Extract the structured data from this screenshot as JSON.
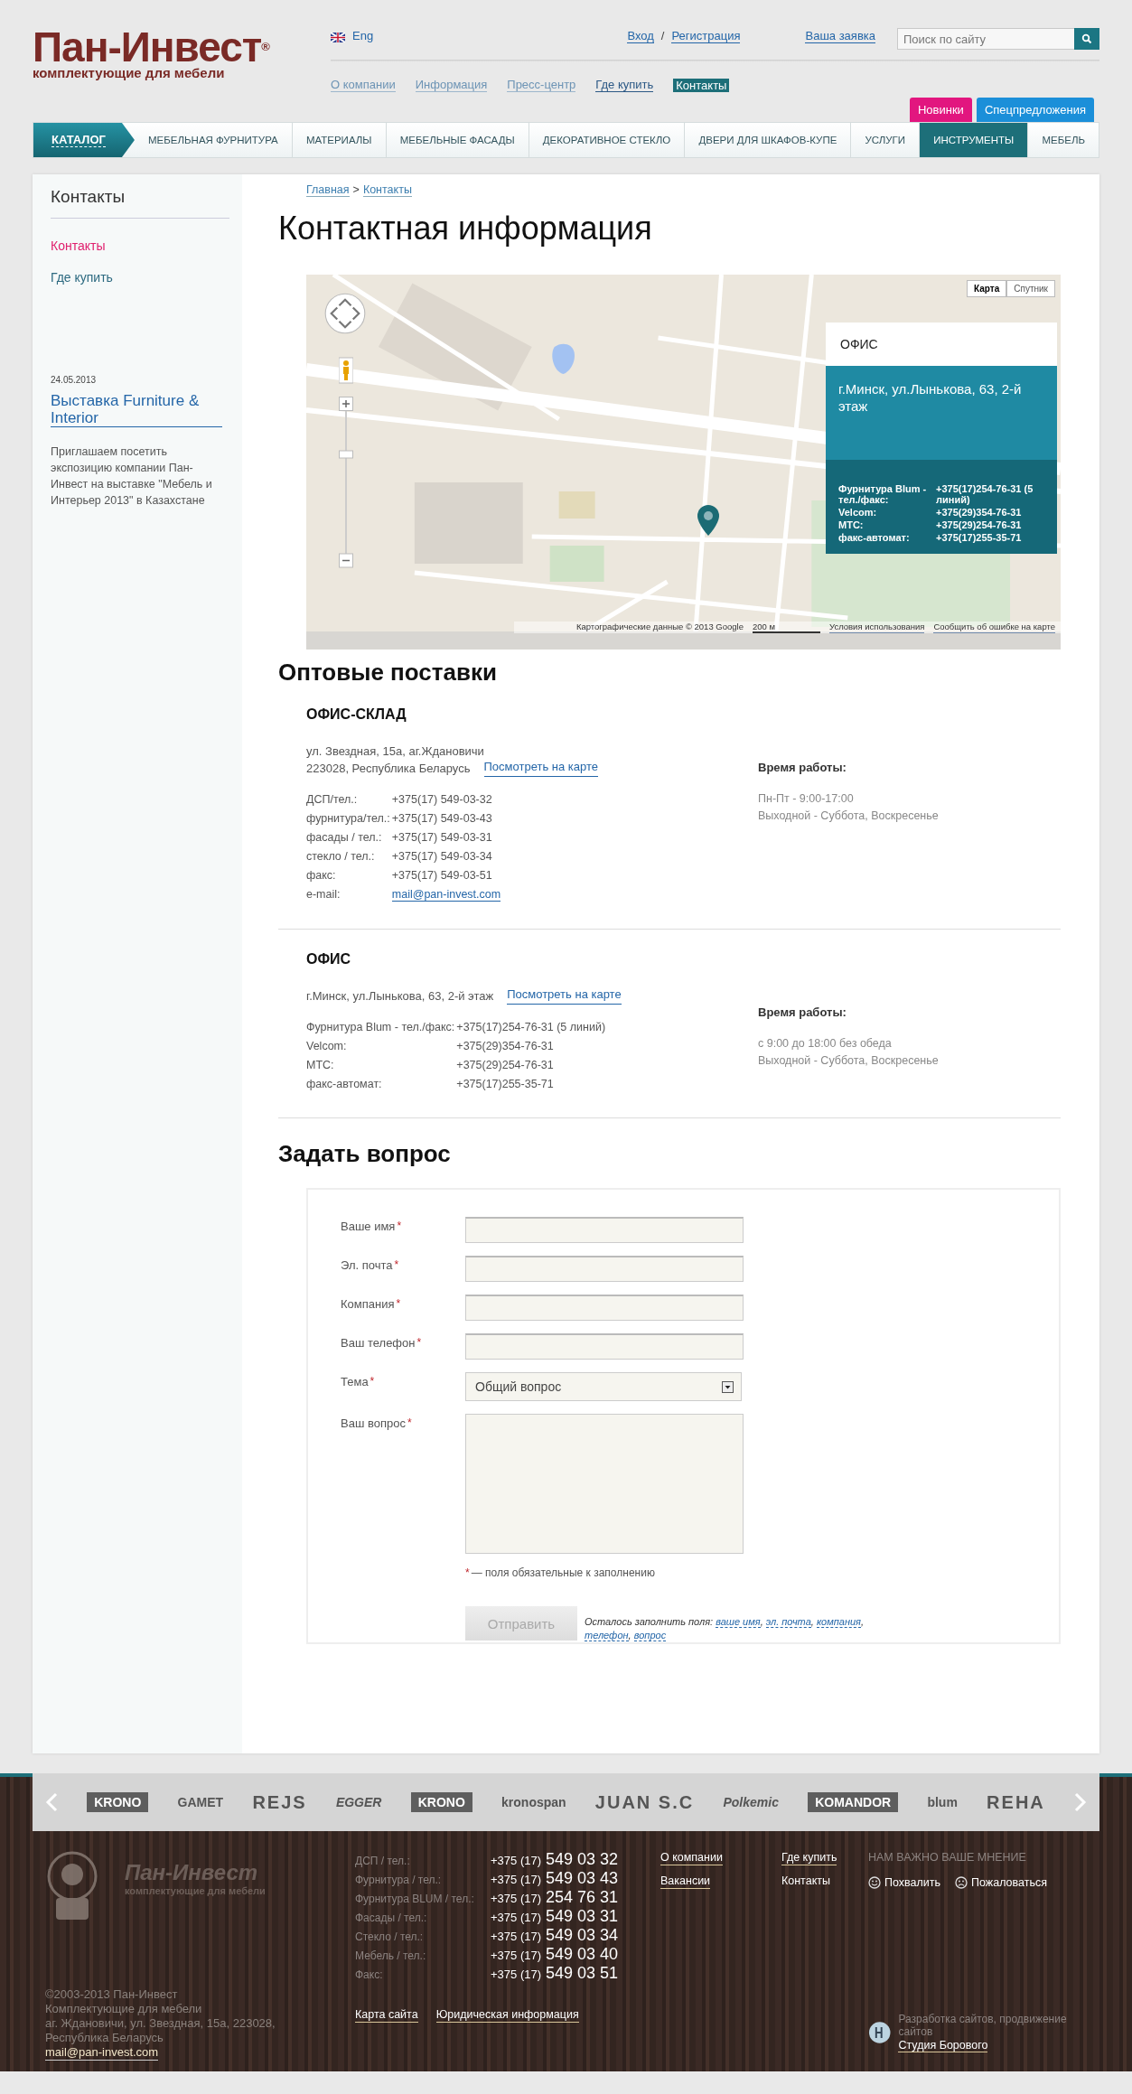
{
  "header": {
    "logo": {
      "title": "Пан-Инвест",
      "registered": "®",
      "tagline": "комплектующие для мебели"
    },
    "language": "Eng",
    "login": "Вход",
    "auth_separator": "/",
    "register": "Регистрация",
    "request_link": "Ваша заявка",
    "search": {
      "placeholder": "Поиск по сайту"
    },
    "top_nav": [
      {
        "label": "О компании",
        "selected": false
      },
      {
        "label": "Информация",
        "selected": false
      },
      {
        "label": "Пресс-центр",
        "selected": false
      },
      {
        "label": "Где купить",
        "selected": false
      },
      {
        "label": "Контакты",
        "selected": true
      }
    ],
    "promo_tabs": [
      {
        "label": "Новинки",
        "color": "#e2167f"
      },
      {
        "label": "Спецпредложения",
        "color": "#1b8fd9"
      }
    ],
    "catalog_nav": [
      {
        "label": "КАТАЛОГ",
        "kind": "catalog"
      },
      {
        "label": "МЕБЕЛЬНАЯ ФУРНИТУРА",
        "kind": "item",
        "selected": false
      },
      {
        "label": "МАТЕРИАЛЫ",
        "kind": "item",
        "selected": false
      },
      {
        "label": "МЕБЕЛЬНЫЕ ФАСАДЫ",
        "kind": "item",
        "selected": false
      },
      {
        "label": "ДЕКОРАТИВНОЕ СТЕКЛО",
        "kind": "item",
        "selected": false
      },
      {
        "label": "ДВЕРИ ДЛЯ ШКАФОВ-КУПЕ",
        "kind": "item",
        "selected": false
      },
      {
        "label": "УСЛУГИ",
        "kind": "item",
        "selected": false
      },
      {
        "label": "ИНСТРУМЕНТЫ",
        "kind": "item",
        "selected": true
      },
      {
        "label": "МЕБЕЛЬ",
        "kind": "item",
        "selected": false
      }
    ]
  },
  "sidebar": {
    "title": "Контакты",
    "items": [
      {
        "label": "Контакты",
        "selected": true
      },
      {
        "label": "Где купить",
        "selected": false
      }
    ],
    "news": {
      "date": "24.05.2013",
      "title": "Выставка Furniture & Interior",
      "text": "Приглашаем посетить экспозицию компании Пан-Инвест на выставке \"Мебель и Интерьер 2013\" в Казахстане"
    }
  },
  "breadcrumbs": {
    "items": [
      "Главная",
      "Контакты"
    ],
    "separator": ">"
  },
  "page_title": "Контактная информация",
  "map": {
    "buttons": [
      {
        "label": "Карта",
        "selected": true
      },
      {
        "label": "Спутник",
        "selected": false
      }
    ],
    "info": {
      "title": "ОФИС",
      "address": "г.Минск, ул.Лынькова, 63, 2-й этаж",
      "phones": [
        {
          "label": "Фурнитура Blum - тел./факс:",
          "value": "+375(17)254-76-31 (5 линий)"
        },
        {
          "label": "Velcom:",
          "value": "+375(29)354-76-31"
        },
        {
          "label": "МТС:",
          "value": "+375(29)254-76-31"
        },
        {
          "label": "факс-автомат:",
          "value": "+375(17)255-35-71"
        }
      ]
    },
    "attribution": "Картографические данные © 2013 Google",
    "scale": "200 м",
    "terms": "Условия использования",
    "report": "Сообщить об ошибке на карте"
  },
  "wholesale": {
    "title": "Оптовые поставки",
    "offices": [
      {
        "name": "ОФИС-СКЛАД",
        "address": [
          "ул. Звездная, 15а, аг.Ждановичи",
          "223028, Республика Беларусь"
        ],
        "map_link": "Посмотреть на карте",
        "phones": [
          {
            "label": "ДСП/тел.:",
            "value": "+375(17) 549-03-32",
            "kind": "text"
          },
          {
            "label": "фурнитура/тел.:",
            "value": "+375(17) 549-03-43",
            "kind": "text"
          },
          {
            "label": "фасады / тел.:",
            "value": "+375(17) 549-03-31",
            "kind": "text"
          },
          {
            "label": "стекло / тел.:",
            "value": "+375(17) 549-03-34",
            "kind": "text"
          },
          {
            "label": "факс:",
            "value": "+375(17) 549-03-51",
            "kind": "text"
          },
          {
            "label": "e-mail:",
            "value": "mail@pan-invest.com",
            "kind": "link"
          }
        ],
        "hours_title": "Время работы:",
        "hours": [
          "Пн-Пт - 9:00-17:00",
          "Выходной - Суббота, Воскресенье"
        ]
      },
      {
        "name": "ОФИС",
        "address": [
          "г.Минск, ул.Лынькова, 63, 2-й этаж"
        ],
        "map_link": "Посмотреть на карте",
        "phones": [
          {
            "label": "Фурнитура Blum - тел./факс:",
            "value": "+375(17)254-76-31 (5 линий)",
            "kind": "text"
          },
          {
            "label": "Velcom:",
            "value": "+375(29)354-76-31",
            "kind": "text"
          },
          {
            "label": "МТС:",
            "value": "+375(29)254-76-31",
            "kind": "text"
          },
          {
            "label": "факс-автомат:",
            "value": "+375(17)255-35-71",
            "kind": "text"
          }
        ],
        "hours_title": "Время работы:",
        "hours": [
          "с 9:00 до 18:00 без обеда",
          "Выходной - Суббота, Воскресенье"
        ]
      }
    ]
  },
  "question_form": {
    "title": "Задать вопрос",
    "required_mark": "*",
    "fields": [
      {
        "label": "Ваше имя",
        "kind": "input",
        "required": true
      },
      {
        "label": "Эл. почта",
        "kind": "input",
        "required": true
      },
      {
        "label": "Компания",
        "kind": "input",
        "required": true
      },
      {
        "label": "Ваш телефон",
        "kind": "input",
        "required": true
      },
      {
        "label": "Тема",
        "kind": "select",
        "required": true,
        "value": "Общий вопрос"
      },
      {
        "label": "Ваш вопрос",
        "kind": "textarea",
        "required": true
      }
    ],
    "required_note": "— поля обязательные к заполнению",
    "submit": {
      "label": "Отправить",
      "disabled": true
    },
    "remaining": {
      "prefix": "Осталось заполнить поля:",
      "separator": ",",
      "fields": [
        "ваше имя",
        "эл. почта",
        "компания",
        "телефон",
        "вопрос"
      ]
    }
  },
  "footer": {
    "brands": [
      "KRONO",
      "GAMET",
      "REJS",
      "EGGER",
      "KRONO",
      "kronospan",
      "JUAN S.C",
      "Polkemic",
      "KOMANDOR",
      "blum",
      "REHA"
    ],
    "logo": {
      "title": "Пан-Инвест",
      "tagline": "комплектующие для мебели"
    },
    "phones": [
      {
        "label": "ДСП / тел.:",
        "code": "+375 (17)",
        "number": "549 03 32"
      },
      {
        "label": "Фурнитура / тел.:",
        "code": "+375 (17)",
        "number": "549 03 43"
      },
      {
        "label": "Фурнитура BLUM / тел.:",
        "code": "+375 (17)",
        "number": "254 76 31"
      },
      {
        "label": "Фасады / тел.:",
        "code": "+375 (17)",
        "number": "549 03 31"
      },
      {
        "label": "Стекло / тел.:",
        "code": "+375 (17)",
        "number": "549 03 34"
      },
      {
        "label": "Мебель / тел.:",
        "code": "+375 (17)",
        "number": "549 03 40"
      },
      {
        "label": "Факс:",
        "code": "+375 (17)",
        "number": "549 03 51"
      }
    ],
    "links_left": [
      {
        "label": "О компании",
        "selected": false
      },
      {
        "label": "Вакансии",
        "selected": false
      }
    ],
    "links_right": [
      {
        "label": "Где купить",
        "selected": false
      },
      {
        "label": "Контакты",
        "selected": true
      }
    ],
    "feedback": {
      "title": "НАМ ВАЖНО ВАШЕ МНЕНИЕ",
      "praise": "Похвалить",
      "complain": "Пожаловаться"
    },
    "copyright": [
      "©2003-2013 Пан-Инвест",
      "Комплектующие для мебели",
      "аг. Ждановичи, ул. Звездная, 15а, 223028,",
      "Республика Беларусь"
    ],
    "email": "mail@pan-invest.com",
    "bottom_links": [
      "Карта сайта",
      "Юридическая информация"
    ],
    "developer": {
      "text": "Разработка сайтов, продвижение сайтов",
      "link": "Студия Борового"
    }
  }
}
